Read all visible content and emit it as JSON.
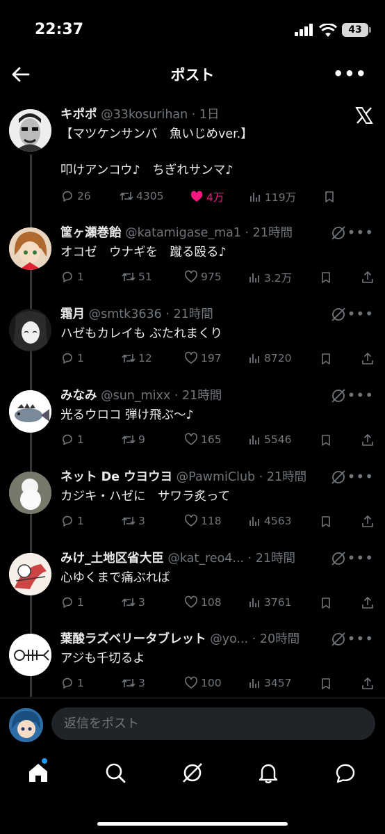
{
  "status": {
    "time": "22:37",
    "battery": "43"
  },
  "header": {
    "title": "ポスト"
  },
  "main_post": {
    "name": "キポポ",
    "handle_time": "@33kosurihan · 1日",
    "lines": [
      "【マツケンサンバ　魚いじめver.】",
      "",
      "叩けアンコウ♪　ちぎれサンマ♪"
    ],
    "replies": "26",
    "reposts": "4305",
    "likes": "4万",
    "views": "119万"
  },
  "replies": [
    {
      "name": "筐ヶ瀬巻飴",
      "handle_time": "@katamigase_ma1 · 21時間",
      "text": "オコゼ　ウナギを　蹴る殴る♪",
      "replies": "1",
      "reposts": "51",
      "likes": "975",
      "views": "3.2万"
    },
    {
      "name": "霜月",
      "handle_time": "@smtk3636 · 21時間",
      "text": "ハゼもカレイも ぶたれまくり",
      "replies": "1",
      "reposts": "12",
      "likes": "197",
      "views": "8720"
    },
    {
      "name": "みなみ",
      "handle_time": "@sun_mixx · 21時間",
      "text": "光るウロコ 弾け飛ぶ〜♪",
      "replies": "1",
      "reposts": "9",
      "likes": "165",
      "views": "5546"
    },
    {
      "name": "ネット De ウヨウヨ",
      "handle_time": "@PawmiClub · 21時間",
      "text": "カジキ・ハゼに　サワラ炙って",
      "replies": "1",
      "reposts": "3",
      "likes": "118",
      "views": "4563"
    },
    {
      "name": "みけ_土地区省大臣",
      "handle_time": "@kat_reo4... · 21時間",
      "text": "心ゆくまで痛ぶれば",
      "replies": "1",
      "reposts": "3",
      "likes": "108",
      "views": "3761"
    },
    {
      "name": "葉酸ラズベリータブレット",
      "handle_time": "@yo... · 20時間",
      "text": "アジも千切るよ",
      "replies": "1",
      "reposts": "3",
      "likes": "100",
      "views": "3457"
    }
  ],
  "composer": {
    "placeholder": "返信をポスト"
  },
  "colors": {
    "like": "#f91880",
    "accent": "#1d9bf0",
    "muted": "#71767b"
  }
}
